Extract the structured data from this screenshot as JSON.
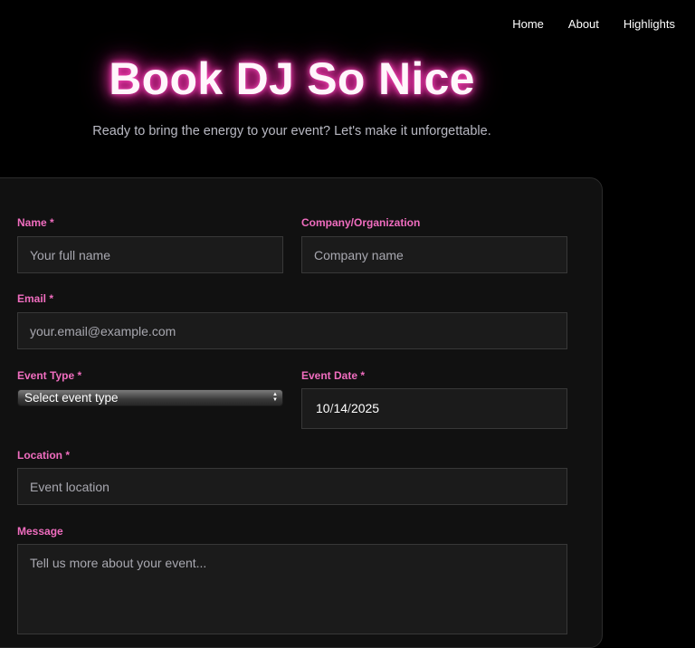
{
  "nav": {
    "items": [
      {
        "label": "Home"
      },
      {
        "label": "About"
      },
      {
        "label": "Highlights"
      }
    ]
  },
  "hero": {
    "title": "Book DJ So Nice",
    "subtitle": "Ready to bring the energy to your event? Let's make it unforgettable."
  },
  "form": {
    "name": {
      "label": "Name *",
      "placeholder": "Your full name",
      "value": ""
    },
    "company": {
      "label": "Company/Organization",
      "placeholder": "Company name",
      "value": ""
    },
    "email": {
      "label": "Email *",
      "placeholder": "your.email@example.com",
      "value": ""
    },
    "event_type": {
      "label": "Event Type *",
      "selected": "Select event type"
    },
    "event_date": {
      "label": "Event Date *",
      "month": "10",
      "day": "14",
      "year": "2025",
      "separator": "/"
    },
    "location": {
      "label": "Location *",
      "placeholder": "Event location",
      "value": ""
    },
    "message": {
      "label": "Message",
      "placeholder": "Tell us more about your event...",
      "value": ""
    }
  },
  "colors": {
    "background": "#000000",
    "accent_pink": "#f06dbf",
    "glow": "#ff2fb0",
    "card": "#111111",
    "field": "#1b1b1b"
  }
}
